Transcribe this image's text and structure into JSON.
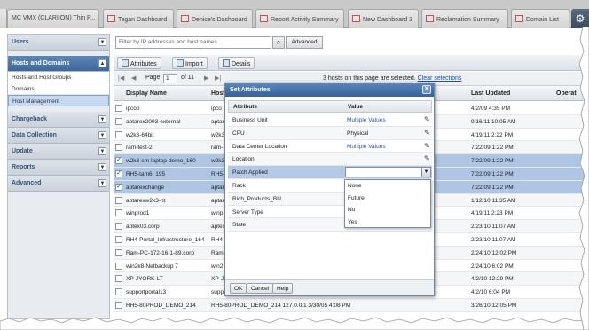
{
  "tabs": [
    {
      "label": "MC VMX (CLARIION) Thin P..."
    },
    {
      "label": "Tegan Dashboard"
    },
    {
      "label": "Denice's Dashboard"
    },
    {
      "label": "Report Activity Summary"
    },
    {
      "label": "New Dashboard 3"
    },
    {
      "label": "Reclamation Summary"
    },
    {
      "label": "Domain List"
    }
  ],
  "sidebar": {
    "sections": [
      {
        "label": "Users"
      },
      {
        "label": "Hosts and Domains"
      },
      {
        "label": "Chargeback"
      },
      {
        "label": "Data Collection"
      },
      {
        "label": "Update"
      },
      {
        "label": "Reports"
      },
      {
        "label": "Advanced"
      }
    ],
    "sub_items": [
      {
        "label": "Hosts and Host Groups"
      },
      {
        "label": "Domains"
      },
      {
        "label": "Host Management"
      }
    ]
  },
  "filter": {
    "placeholder": "Filter by IP addresses and host names...",
    "advanced_label": "Advanced"
  },
  "toolbar": {
    "attributes_label": "Attributes",
    "import_label": "Import",
    "details_label": "Details"
  },
  "pager": {
    "page_label": "Page",
    "page_value": "1",
    "of_label": "of 11",
    "selected_text": "3 hosts on this page are selected.",
    "clear_label": "Clear selections"
  },
  "grid": {
    "columns": [
      "Display Name",
      "Host",
      "Last Updated",
      "Operat"
    ],
    "rows": [
      {
        "name": "ipcop",
        "host": "ipco",
        "updated": "4/2/09 4:35 PM",
        "checked": false
      },
      {
        "name": "aptarex2003-external",
        "host": "aptar",
        "updated": "9/16/11 10:05 AM",
        "checked": false
      },
      {
        "name": "w2k3-64bit",
        "host": "w2k3",
        "updated": "4/19/11 2:22 PM",
        "checked": false
      },
      {
        "name": "ram-test-2",
        "host": "ram-",
        "updated": "7/22/09 1:22 PM",
        "checked": false
      },
      {
        "name": "w2k3-sm-laptop-demo_160",
        "host": "w2k3",
        "updated": "7/22/09 1:22 PM",
        "checked": true
      },
      {
        "name": "RH5-tam6_195",
        "host": "RH5-",
        "updated": "7/22/09 1:22 PM",
        "checked": true
      },
      {
        "name": "aptarexchange",
        "host": "aptar",
        "updated": "7/22/09 1:22 PM",
        "checked": true
      },
      {
        "name": "aptarexw2k3-nt",
        "host": "aptar",
        "updated": "1/12/10 11:35 AM",
        "checked": false
      },
      {
        "name": "winprod1",
        "host": "winp",
        "updated": "4/19/11 2:23 PM",
        "checked": false
      },
      {
        "name": "aptex03.corp",
        "host": "aptex",
        "updated": "2/23/10 11:07 AM",
        "checked": false
      },
      {
        "name": "RH4-Portal_Infrastructure_164",
        "host": "RH4-",
        "updated": "2/23/10 11:07 AM",
        "checked": false
      },
      {
        "name": "Ram-PC-172-16-1-89.corp",
        "host": "Ram-",
        "updated": "2/24/10 12:02 PM",
        "checked": false
      },
      {
        "name": "win2k8-Netbackup 7",
        "host": "win2",
        "updated": "2/24/10 6:02 PM",
        "checked": false
      },
      {
        "name": "XP-JYORK-LT",
        "host": "XP-J",
        "updated": "4/2/10 12:29 PM",
        "checked": false
      },
      {
        "name": "supportportal13",
        "host": "supp",
        "updated": "4/2/10 6:04 PM",
        "checked": false
      },
      {
        "name": "RH5-80PROD_DEMO_214",
        "host": "RH5-80PROD_DEMO_214     127.0.0.1     3/30/05 4:08 PM",
        "updated": "3/26/10 12:05 PM",
        "checked": false
      }
    ]
  },
  "modal": {
    "title": "Set Attributes",
    "col_attribute": "Attribute",
    "col_value": "Value",
    "rows": [
      {
        "attribute": "Business Unit",
        "value": "Multiple Values",
        "link": true
      },
      {
        "attribute": "CPU",
        "value": "Physical",
        "link": false
      },
      {
        "attribute": "Data Center Location",
        "value": "Multiple Values",
        "link": true
      },
      {
        "attribute": "Location",
        "value": "",
        "link": false
      },
      {
        "attribute": "Patch Applied",
        "value": "",
        "link": false
      },
      {
        "attribute": "Rack",
        "value": "",
        "link": false
      },
      {
        "attribute": "Rich_Products_BU",
        "value": "",
        "link": false
      },
      {
        "attribute": "Server Type",
        "value": "",
        "link": false
      },
      {
        "attribute": "State",
        "value": "",
        "link": false
      }
    ],
    "dropdown_options": [
      "None",
      "Future",
      "No",
      "Yes"
    ],
    "ok_label": "OK",
    "cancel_label": "Cancel",
    "help_label": "Help"
  },
  "colors": {
    "accent": "#3e6899",
    "selected_row": "#aec6e4",
    "link": "#2a56a8"
  }
}
